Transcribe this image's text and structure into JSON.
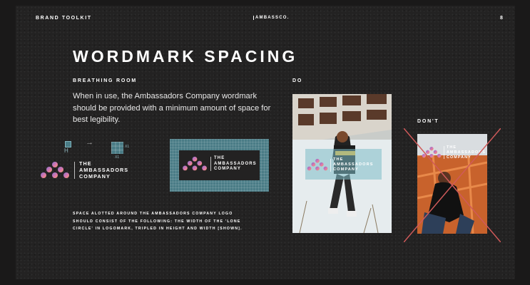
{
  "header": {
    "left": "BRAND TOOLKIT",
    "center": "AMBASSCO.",
    "page_number": "8"
  },
  "title": "WORDMARK SPACING",
  "breathing_room": {
    "heading": "BREATHING ROOM",
    "body": "When in use, the Ambassadors Company wordmark should be provided with a minimum amount of space for best legibility."
  },
  "logo_lines": [
    "THE",
    "AMBASSADORS",
    "COMPANY"
  ],
  "diagram": {
    "h_label": "H",
    "x1_a": "X1",
    "x1_b": "X1"
  },
  "footnote": "SPACE ALOTTED AROUND THE AMBASSADORS COMPANY LOGO SHOULD CONSIST OF THE FOLLOWING: THE WIDTH OF THE 'LONE CIRCLE' IN LOGOMARK, TRIPLED IN HEIGHT AND WIDTH [SHOWN].",
  "do_label": "DO",
  "dont_label": "DON'T",
  "colors": {
    "background": "#232222",
    "teal": "#4a7c86",
    "logo_purple": "#8a6fd0",
    "logo_pink": "#e07aa8",
    "logo_orange": "#f0a060",
    "cross_red": "#d05a5a"
  }
}
